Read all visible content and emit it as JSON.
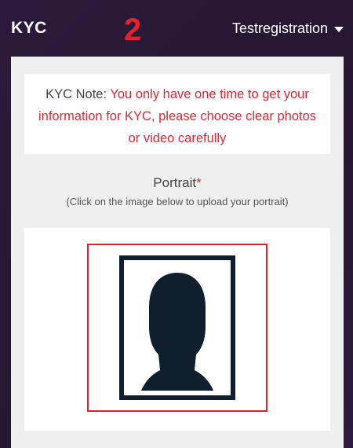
{
  "header": {
    "brand": "KYC",
    "step_number": "2",
    "user_menu_label": "Testregistration"
  },
  "note": {
    "label": "KYC Note:",
    "text": "You only have one time to get your information for KYC, please choose clear photos or video carefully"
  },
  "portrait": {
    "title": "Portrait",
    "required_marker": "*",
    "hint": "(Click on the image below to upload your portrait)",
    "placeholder_icon": "person-silhouette-icon"
  },
  "colors": {
    "header_bg": "#2a1a3a",
    "accent_red": "#d22b3a",
    "frame_red": "#d7262e",
    "silhouette": "#0f1f2e"
  }
}
